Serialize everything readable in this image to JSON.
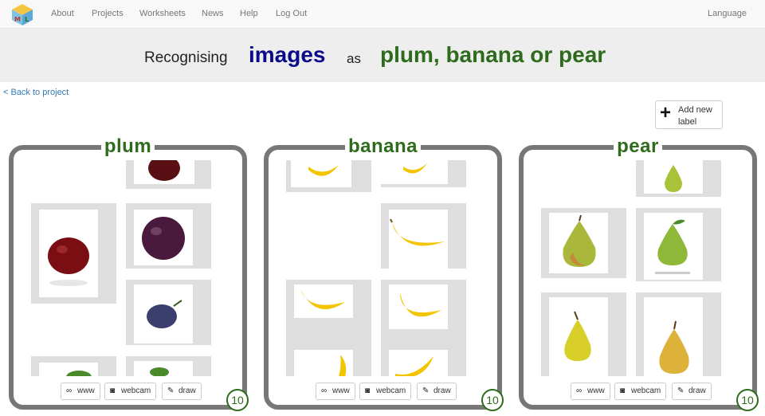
{
  "nav": {
    "items": [
      "About",
      "Projects",
      "Worksheets",
      "News",
      "Help",
      "Log Out"
    ],
    "language": "Language"
  },
  "banner": {
    "recognising": "Recognising",
    "type": "images",
    "as": "as",
    "labels": "plum, banana or pear"
  },
  "back_link": "< Back to project",
  "add_label": {
    "icon": "plus-icon",
    "text": "Add new label"
  },
  "buckets": [
    {
      "label": "plum",
      "count": "10",
      "buttons": {
        "www": "www",
        "webcam": "webcam",
        "draw": "draw"
      }
    },
    {
      "label": "banana",
      "count": "10",
      "buttons": {
        "www": "www",
        "webcam": "webcam",
        "draw": "draw"
      }
    },
    {
      "label": "pear",
      "count": "10",
      "buttons": {
        "www": "www",
        "webcam": "webcam",
        "draw": "draw"
      }
    }
  ],
  "colors": {
    "label_green": "#2e6b1c",
    "images_blue": "#0a0a8a",
    "bucket_border": "#777777",
    "cell_grey": "#dedede"
  }
}
